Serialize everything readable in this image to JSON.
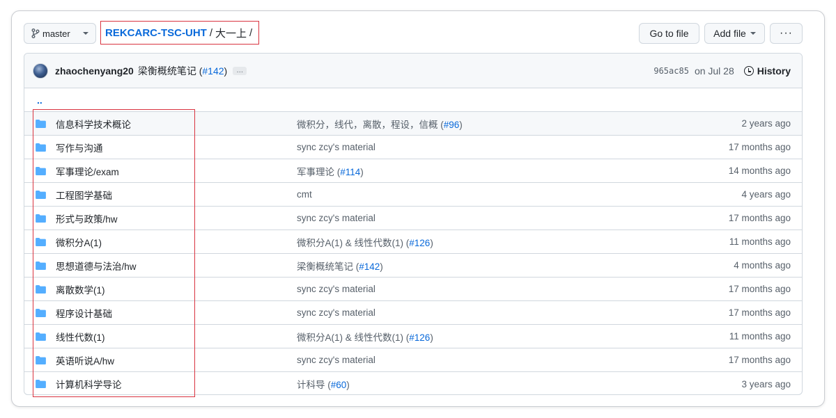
{
  "toolbar": {
    "branch": "master",
    "repo": "REKCARC-TSC-UHT",
    "path": "大一上",
    "sep": "/",
    "goto_file": "Go to file",
    "add_file": "Add file",
    "more": "···"
  },
  "commit": {
    "author": "zhaochenyang20",
    "message": "梁衡概统笔记",
    "pr": "#142",
    "ellipsis": "…",
    "sha": "965ac85",
    "date": "on Jul 28",
    "history": "History"
  },
  "parent_dir": "..",
  "files": [
    {
      "name": "信息科学技术概论",
      "msg": "微积分，线代，离散，程设，信概",
      "pr": "#96",
      "age": "2 years ago"
    },
    {
      "name": "写作与沟通",
      "msg": "sync zcy's material",
      "pr": "",
      "age": "17 months ago"
    },
    {
      "name": "军事理论/exam",
      "msg": "军事理论",
      "pr": "#114",
      "age": "14 months ago"
    },
    {
      "name": "工程图学基础",
      "msg": "cmt",
      "pr": "",
      "age": "4 years ago"
    },
    {
      "name": "形式与政策/hw",
      "msg": "sync zcy's material",
      "pr": "",
      "age": "17 months ago"
    },
    {
      "name": "微积分A(1)",
      "msg": "微积分A(1) & 线性代数(1)",
      "pr": "#126",
      "age": "11 months ago"
    },
    {
      "name": "思想道德与法治/hw",
      "msg": "梁衡概统笔记",
      "pr": "#142",
      "age": "4 months ago"
    },
    {
      "name": "离散数学(1)",
      "msg": "sync zcy's material",
      "pr": "",
      "age": "17 months ago"
    },
    {
      "name": "程序设计基础",
      "msg": "sync zcy's material",
      "pr": "",
      "age": "17 months ago"
    },
    {
      "name": "线性代数(1)",
      "msg": "微积分A(1) & 线性代数(1)",
      "pr": "#126",
      "age": "11 months ago"
    },
    {
      "name": "英语听说A/hw",
      "msg": "sync zcy's material",
      "pr": "",
      "age": "17 months ago"
    },
    {
      "name": "计算机科学导论",
      "msg": "计科导",
      "pr": "#60",
      "age": "3 years ago"
    }
  ],
  "colors": {
    "link": "#0969da",
    "folder": "#54aeff",
    "highlight": "#d9333f"
  }
}
